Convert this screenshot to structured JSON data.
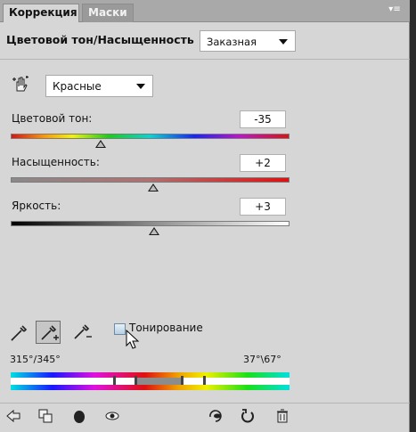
{
  "tabs": [
    {
      "label": "Коррекция",
      "active": true
    },
    {
      "label": "Маски",
      "active": false
    }
  ],
  "panel_menu_icon": "panel-menu-icon",
  "header": {
    "title": "Цветовой тон/Насыщенность",
    "preset": "Заказная"
  },
  "channel": {
    "selected": "Красные",
    "icon": "target-adjust-hand-icon"
  },
  "adjustments": [
    {
      "label": "Цветовой тон:",
      "value": "-35",
      "range": [
        -180,
        180
      ]
    },
    {
      "label": "Насыщенность:",
      "value": "+2",
      "range": [
        -100,
        100
      ]
    },
    {
      "label": "Яркость:",
      "value": "+3",
      "range": [
        -100,
        100
      ]
    }
  ],
  "tools": [
    "eyedropper-icon",
    "eyedropper-plus-icon",
    "eyedropper-minus-icon"
  ],
  "colorize": {
    "label": "Тонирование",
    "checked": false
  },
  "range_readout": {
    "left": "315°/345°",
    "right": "37°\\67°"
  },
  "footer_icons": [
    "back-arrow-icon",
    "clip-layer-icon",
    "layer-mask-icon",
    "visibility-eye-icon",
    "view-previous-icon",
    "reset-icon",
    "trash-icon"
  ],
  "colors": {
    "panel_bg": "#d6d6d6",
    "tab_bar_bg": "#a9a9a9",
    "field_bg": "#ffffff"
  }
}
